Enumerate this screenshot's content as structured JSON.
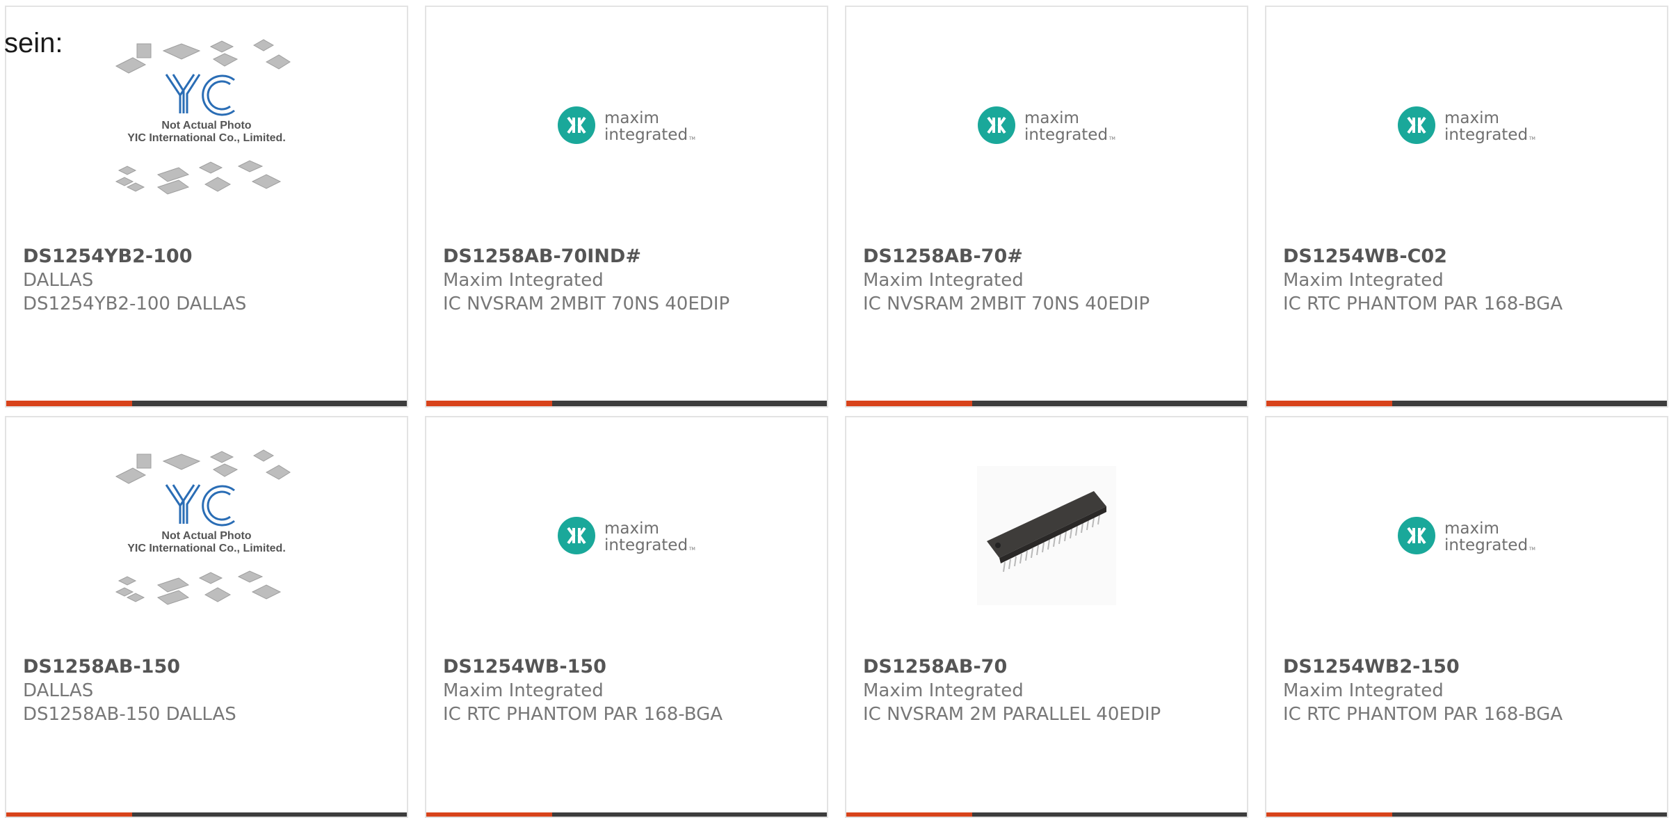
{
  "page": {
    "label": "sein:"
  },
  "colors": {
    "accent": "#d8431b",
    "bar_dark": "#3d3d3d",
    "maxim_teal": "#1aa89a",
    "yic_blue": "#2a6db5"
  },
  "placeholder": {
    "line1": "Not Actual Photo",
    "line2": "YIC International Co., Limited."
  },
  "maxim_logo": {
    "word1": "maxim",
    "word2": "integrated",
    "tm": "TM"
  },
  "products": [
    {
      "part_number": "DS1254YB2-100",
      "manufacturer": "DALLAS",
      "description": "DS1254YB2-100 DALLAS",
      "image": "yic-placeholder"
    },
    {
      "part_number": "DS1258AB-70IND#",
      "manufacturer": "Maxim Integrated",
      "description": "IC NVSRAM 2MBIT 70NS 40EDIP",
      "image": "maxim-logo"
    },
    {
      "part_number": "DS1258AB-70#",
      "manufacturer": "Maxim Integrated",
      "description": "IC NVSRAM 2MBIT 70NS 40EDIP",
      "image": "maxim-logo"
    },
    {
      "part_number": "DS1254WB-C02",
      "manufacturer": "Maxim Integrated",
      "description": "IC RTC PHANTOM PAR 168-BGA",
      "image": "maxim-logo"
    },
    {
      "part_number": "DS1258AB-150",
      "manufacturer": "DALLAS",
      "description": "DS1258AB-150 DALLAS",
      "image": "yic-placeholder"
    },
    {
      "part_number": "DS1254WB-150",
      "manufacturer": "Maxim Integrated",
      "description": "IC RTC PHANTOM PAR 168-BGA",
      "image": "maxim-logo"
    },
    {
      "part_number": "DS1258AB-70",
      "manufacturer": "Maxim Integrated",
      "description": "IC NVSRAM 2M PARALLEL 40EDIP",
      "image": "dip-chip-photo"
    },
    {
      "part_number": "DS1254WB2-150",
      "manufacturer": "Maxim Integrated",
      "description": "IC RTC PHANTOM PAR 168-BGA",
      "image": "maxim-logo"
    }
  ]
}
